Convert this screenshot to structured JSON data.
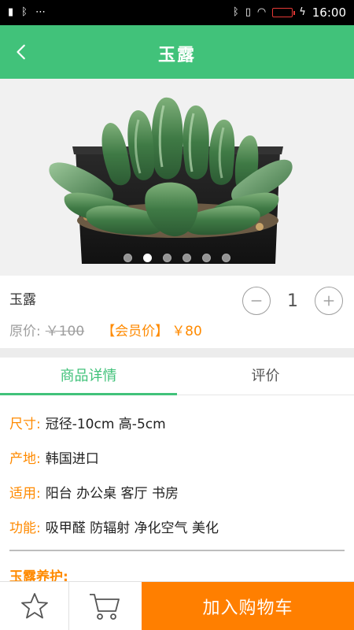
{
  "status_bar": {
    "left_icons": [
      "signal-icon",
      "bluetooth-icon",
      "more-icon"
    ],
    "right_icons": [
      "bluetooth-icon",
      "vibrate-icon",
      "wifi-icon",
      "battery-icon",
      "charging-icon"
    ],
    "time": "16:00"
  },
  "header": {
    "title": "玉露",
    "back_icon": "chevron-left-icon"
  },
  "hero": {
    "page_count": 6,
    "active_page": 2
  },
  "product": {
    "name": "玉露",
    "quantity": "1",
    "original_price_label": "原价:",
    "original_price": "￥100",
    "member_price_label": "【会员价】",
    "member_price": "￥80"
  },
  "tabs": [
    {
      "label": "商品详情",
      "active": true
    },
    {
      "label": "评价",
      "active": false
    }
  ],
  "details": {
    "size_label": "尺寸:",
    "size_value": "冠径-10cm  高-5cm",
    "origin_label": "产地:",
    "origin_value": "韩国进口",
    "usage_label": "适用:",
    "usage_value": "阳台  办公桌  客厅  书房",
    "function_label": "功能:",
    "function_value": "吸甲醛  防辐射  净化空气 美化",
    "care_title": "玉露养护:"
  },
  "bottom_bar": {
    "favorite_icon": "star-icon",
    "cart_icon": "cart-icon",
    "add_to_cart": "加入购物车"
  },
  "colors": {
    "accent_green": "#41c27a",
    "accent_orange": "#ff7f00",
    "label_orange": "#ff8a00"
  }
}
